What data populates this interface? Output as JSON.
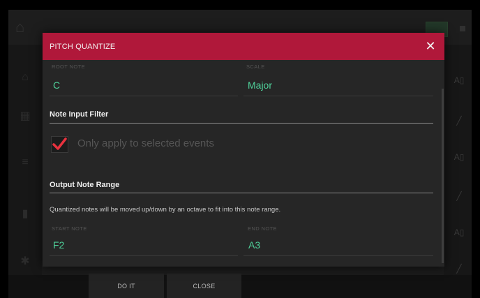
{
  "dialog": {
    "title": "PITCH QUANTIZE",
    "close_icon": "close-icon",
    "root_note": {
      "label": "ROOT NOTE",
      "value": "C"
    },
    "scale": {
      "label": "SCALE",
      "value": "Major"
    },
    "note_input_filter": {
      "title": "Note Input Filter",
      "checkbox_label": "Only apply to selected events",
      "checked": true
    },
    "output_note_range": {
      "title": "Output Note Range",
      "description": "Quantized notes will be moved up/down by an octave to fit into this note range.",
      "start_note": {
        "label": "START NOTE",
        "value": "F2"
      },
      "end_note": {
        "label": "END NOTE",
        "value": "A3"
      }
    }
  },
  "footer": {
    "do_it_label": "DO IT",
    "close_label": "CLOSE"
  },
  "colors": {
    "header_red": "#b0183a",
    "value_green": "#4fd19a",
    "check_red": "#e8323e"
  }
}
